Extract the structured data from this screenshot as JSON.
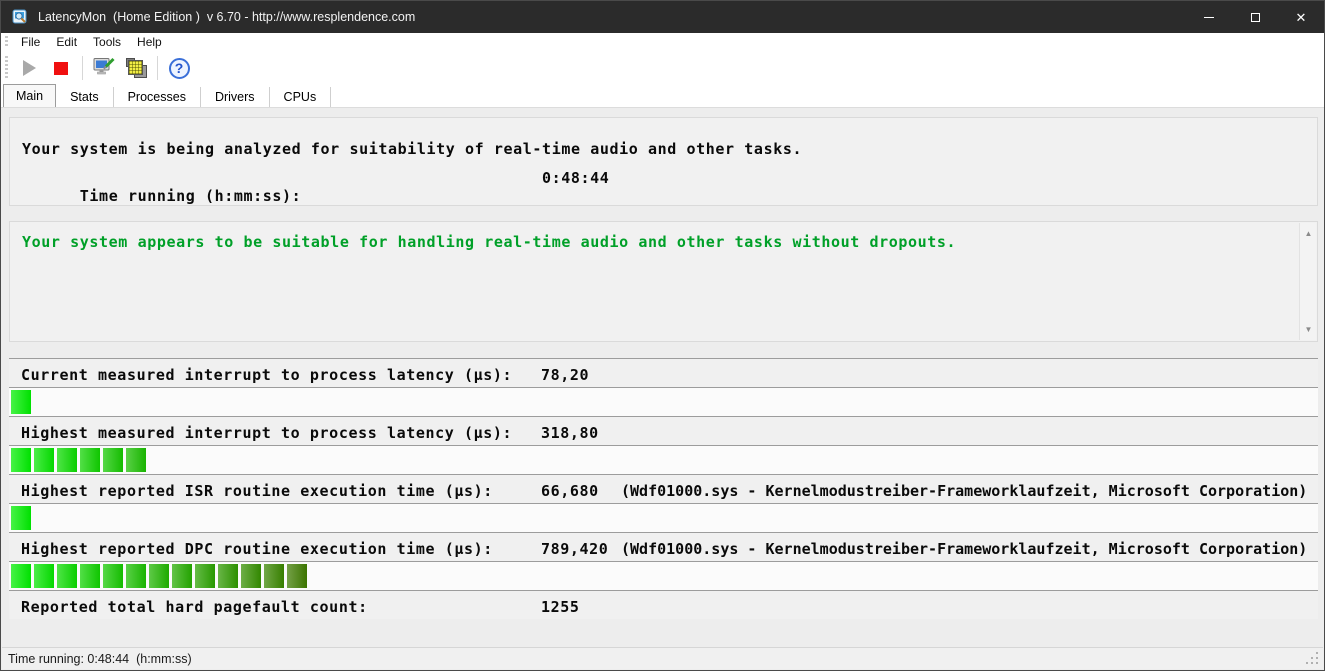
{
  "window": {
    "title": "LatencyMon  (Home Edition )  v 6.70 - http://www.resplendence.com",
    "close_glyph": "✕"
  },
  "menu": {
    "items": [
      "File",
      "Edit",
      "Tools",
      "Help"
    ]
  },
  "toolbar": {
    "help_glyph": "?"
  },
  "tabs": {
    "items": [
      "Main",
      "Stats",
      "Processes",
      "Drivers",
      "CPUs"
    ],
    "active": "Main"
  },
  "analysis": {
    "line1": "Your system is being analyzed for suitability of real-time audio and other tasks.",
    "time_label": "Time running (h:mm:ss):",
    "time_value": "0:48:44"
  },
  "status_message": {
    "text": "Your system appears to be suitable for handling real-time audio and other tasks without dropouts.",
    "color": "#00a028"
  },
  "scrollbar": {
    "up_glyph": "▲",
    "down_glyph": "▼"
  },
  "measurements": {
    "rows": [
      {
        "label": "Current measured interrupt to process latency (µs):",
        "value": "78,20",
        "extra": "",
        "segments": 1
      },
      {
        "label": "Highest measured interrupt to process latency (µs):",
        "value": "318,80",
        "extra": "",
        "segments": 6
      },
      {
        "label": "Highest reported ISR routine execution time (µs):",
        "value": "66,680",
        "extra": "(Wdf01000.sys - Kernelmodustreiber-Frameworklaufzeit, Microsoft Corporation)",
        "segments": 1
      },
      {
        "label": "Highest reported DPC routine execution time (µs):",
        "value": "789,420",
        "extra": "(Wdf01000.sys - Kernelmodustreiber-Frameworklaufzeit, Microsoft Corporation)",
        "segments": 13
      },
      {
        "label": "Reported total hard pagefault count:",
        "value": "1255",
        "extra": "",
        "segments": 0
      }
    ],
    "bar": {
      "color_start": "#00ee00",
      "color_end": "#3f7c00",
      "max_segments": 13
    }
  },
  "statusbar": {
    "text": "Time running: 0:48:44  (h:mm:ss)"
  }
}
